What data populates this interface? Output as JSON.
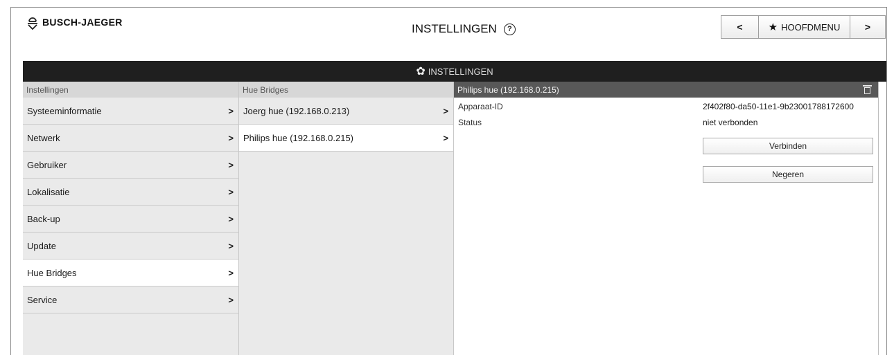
{
  "header": {
    "brand": "BUSCH-JAEGER",
    "title": "INSTELLINGEN",
    "help_icon": "?",
    "prev_label": "<",
    "main_menu_label": "HOOFDMENU",
    "next_label": ">"
  },
  "dark_bar": {
    "label": "INSTELLINGEN"
  },
  "settings_column": {
    "heading": "Instellingen",
    "items": [
      {
        "label": "Systeeminformatie"
      },
      {
        "label": "Netwerk"
      },
      {
        "label": "Gebruiker"
      },
      {
        "label": "Lokalisatie"
      },
      {
        "label": "Back-up"
      },
      {
        "label": "Update"
      },
      {
        "label": "Hue Bridges"
      },
      {
        "label": "Service"
      }
    ]
  },
  "bridges_column": {
    "heading": "Hue Bridges",
    "items": [
      {
        "label": "Joerg hue (192.168.0.213)"
      },
      {
        "label": "Philips hue (192.168.0.215)"
      }
    ]
  },
  "detail": {
    "heading": "Philips hue (192.168.0.215)",
    "device_id_label": "Apparaat-ID",
    "device_id_value": "2f402f80-da50-11e1-9b23001788172600",
    "status_label": "Status",
    "status_value": "niet verbonden",
    "connect_label": "Verbinden",
    "ignore_label": "Negeren"
  },
  "icons": {
    "logo": "busch-jaeger-logo-icon",
    "help": "help-icon",
    "star": "star-icon",
    "gear": "gear-icon",
    "trash": "trash-icon",
    "chevron": "chevron-right-icon"
  },
  "colors": {
    "dark_bar": "#1f1f1f",
    "detail_header": "#585858",
    "column_bg": "#eaeaea",
    "selected_bg": "#ffffff"
  }
}
